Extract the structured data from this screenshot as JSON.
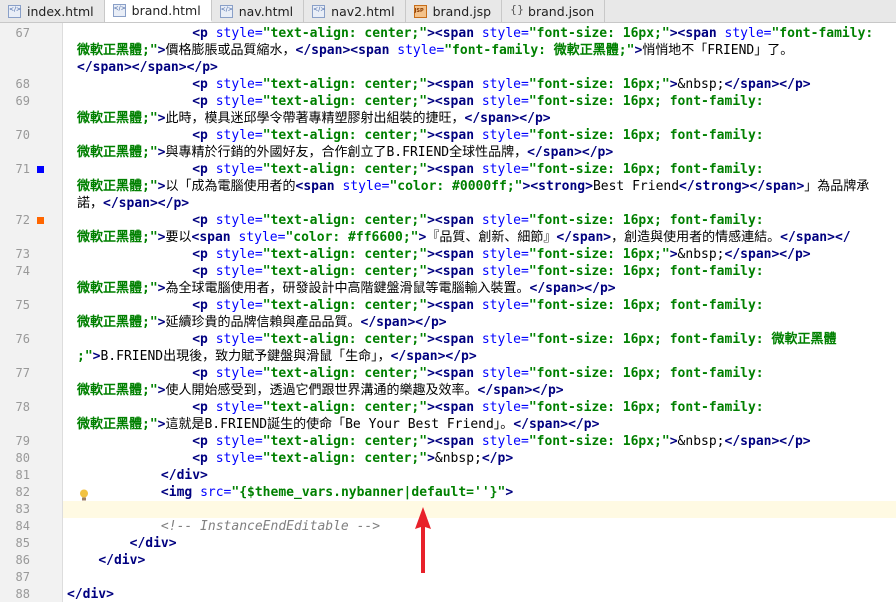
{
  "tabs": [
    {
      "label": "index.html",
      "icon": "html-file-icon",
      "active": false
    },
    {
      "label": "brand.html",
      "icon": "html-file-icon",
      "active": true
    },
    {
      "label": "nav.html",
      "icon": "html-file-icon",
      "active": false
    },
    {
      "label": "nav2.html",
      "icon": "html-file-icon",
      "active": false
    },
    {
      "label": "brand.jsp",
      "icon": "jsp-file-icon",
      "active": false
    },
    {
      "label": "brand.json",
      "icon": "json-file-icon",
      "active": false
    }
  ],
  "colors": {
    "marker_blue": "#0000ff",
    "marker_orange": "#ff6600",
    "arrow_red": "#e8212a"
  },
  "lines": [
    {
      "n": "67",
      "parts": [
        [
          "i",
          "                "
        ],
        [
          "t",
          "<p "
        ],
        [
          "a",
          "style="
        ],
        [
          "v",
          "\"text-align: center;\""
        ],
        [
          "t",
          ">"
        ],
        [
          "t",
          "<span "
        ],
        [
          "a",
          "style="
        ],
        [
          "v",
          "\"font-size: 16px;\""
        ],
        [
          "t",
          ">"
        ],
        [
          "t",
          "<span "
        ],
        [
          "a",
          "style="
        ],
        [
          "v",
          "\"font-family:"
        ]
      ]
    },
    {
      "n": "",
      "wrap": true,
      "parts": [
        [
          "v",
          "微軟正黑體;\""
        ],
        [
          "t",
          ">"
        ],
        [
          "i",
          "價格膨脹或品質縮水，"
        ],
        [
          "t",
          "</span>"
        ],
        [
          "t",
          "<span "
        ],
        [
          "a",
          "style="
        ],
        [
          "v",
          "\"font-family: 微軟正黑體;\""
        ],
        [
          "t",
          ">"
        ],
        [
          "i",
          "悄悄地不「FRIEND」了。"
        ]
      ]
    },
    {
      "n": "",
      "wrap": true,
      "parts": [
        [
          "t",
          "</span></span></p>"
        ]
      ]
    },
    {
      "n": "68",
      "parts": [
        [
          "i",
          "                "
        ],
        [
          "t",
          "<p "
        ],
        [
          "a",
          "style="
        ],
        [
          "v",
          "\"text-align: center;\""
        ],
        [
          "t",
          ">"
        ],
        [
          "t",
          "<span "
        ],
        [
          "a",
          "style="
        ],
        [
          "v",
          "\"font-size: 16px;\""
        ],
        [
          "t",
          ">"
        ],
        [
          "i",
          "&nbsp;"
        ],
        [
          "t",
          "</span></p>"
        ]
      ]
    },
    {
      "n": "69",
      "parts": [
        [
          "i",
          "                "
        ],
        [
          "t",
          "<p "
        ],
        [
          "a",
          "style="
        ],
        [
          "v",
          "\"text-align: center;\""
        ],
        [
          "t",
          ">"
        ],
        [
          "t",
          "<span "
        ],
        [
          "a",
          "style="
        ],
        [
          "v",
          "\"font-size: 16px; font-family:"
        ]
      ]
    },
    {
      "n": "",
      "wrap": true,
      "parts": [
        [
          "v",
          "微軟正黑體;\""
        ],
        [
          "t",
          ">"
        ],
        [
          "i",
          "此時，模具迷邱學令帶著專精塑膠射出組裝的捷旺，"
        ],
        [
          "t",
          "</span></p>"
        ]
      ]
    },
    {
      "n": "70",
      "parts": [
        [
          "i",
          "                "
        ],
        [
          "t",
          "<p "
        ],
        [
          "a",
          "style="
        ],
        [
          "v",
          "\"text-align: center;\""
        ],
        [
          "t",
          ">"
        ],
        [
          "t",
          "<span "
        ],
        [
          "a",
          "style="
        ],
        [
          "v",
          "\"font-size: 16px; font-family:"
        ]
      ]
    },
    {
      "n": "",
      "wrap": true,
      "parts": [
        [
          "v",
          "微軟正黑體;\""
        ],
        [
          "t",
          ">"
        ],
        [
          "i",
          "與專精於行銷的外國好友，合作創立了B.FRIEND全球性品牌，"
        ],
        [
          "t",
          "</span></p>"
        ]
      ]
    },
    {
      "n": "71",
      "mark": "blue",
      "parts": [
        [
          "i",
          "                "
        ],
        [
          "t",
          "<p "
        ],
        [
          "a",
          "style="
        ],
        [
          "v",
          "\"text-align: center;\""
        ],
        [
          "t",
          ">"
        ],
        [
          "t",
          "<span "
        ],
        [
          "a",
          "style="
        ],
        [
          "v",
          "\"font-size: 16px; font-family:"
        ]
      ]
    },
    {
      "n": "",
      "wrap": true,
      "parts": [
        [
          "v",
          "微軟正黑體;\""
        ],
        [
          "t",
          ">"
        ],
        [
          "i",
          "以「成為電腦使用者的"
        ],
        [
          "t",
          "<span "
        ],
        [
          "a",
          "style="
        ],
        [
          "v",
          "\"color: #0000ff;\""
        ],
        [
          "t",
          ">"
        ],
        [
          "t",
          "<strong>"
        ],
        [
          "i",
          "Best Friend"
        ],
        [
          "t",
          "</strong></span>"
        ],
        [
          "i",
          "」為品牌承"
        ]
      ]
    },
    {
      "n": "",
      "wrap": true,
      "parts": [
        [
          "i",
          "諾，"
        ],
        [
          "t",
          "</span></p>"
        ]
      ]
    },
    {
      "n": "72",
      "mark": "orange",
      "parts": [
        [
          "i",
          "                "
        ],
        [
          "t",
          "<p "
        ],
        [
          "a",
          "style="
        ],
        [
          "v",
          "\"text-align: center;\""
        ],
        [
          "t",
          ">"
        ],
        [
          "t",
          "<span "
        ],
        [
          "a",
          "style="
        ],
        [
          "v",
          "\"font-size: 16px; font-family:"
        ]
      ]
    },
    {
      "n": "",
      "wrap": true,
      "parts": [
        [
          "v",
          "微軟正黑體;\""
        ],
        [
          "t",
          ">"
        ],
        [
          "i",
          "要以"
        ],
        [
          "t",
          "<span "
        ],
        [
          "a",
          "style="
        ],
        [
          "v",
          "\"color: #ff6600;\""
        ],
        [
          "t",
          ">"
        ],
        [
          "i",
          "『品質、創新、細節』"
        ],
        [
          "t",
          "</span>"
        ],
        [
          "i",
          "，創造與使用者的情感連結。"
        ],
        [
          "t",
          "</span></"
        ]
      ]
    },
    {
      "n": "73",
      "parts": [
        [
          "i",
          "                "
        ],
        [
          "t",
          "<p "
        ],
        [
          "a",
          "style="
        ],
        [
          "v",
          "\"text-align: center;\""
        ],
        [
          "t",
          ">"
        ],
        [
          "t",
          "<span "
        ],
        [
          "a",
          "style="
        ],
        [
          "v",
          "\"font-size: 16px;\""
        ],
        [
          "t",
          ">"
        ],
        [
          "i",
          "&nbsp;"
        ],
        [
          "t",
          "</span></p>"
        ]
      ]
    },
    {
      "n": "74",
      "parts": [
        [
          "i",
          "                "
        ],
        [
          "t",
          "<p "
        ],
        [
          "a",
          "style="
        ],
        [
          "v",
          "\"text-align: center;\""
        ],
        [
          "t",
          ">"
        ],
        [
          "t",
          "<span "
        ],
        [
          "a",
          "style="
        ],
        [
          "v",
          "\"font-size: 16px; font-family:"
        ]
      ]
    },
    {
      "n": "",
      "wrap": true,
      "parts": [
        [
          "v",
          "微軟正黑體;\""
        ],
        [
          "t",
          ">"
        ],
        [
          "i",
          "為全球電腦使用者，研發設計中高階鍵盤滑鼠等電腦輸入裝置。"
        ],
        [
          "t",
          "</span></p>"
        ]
      ]
    },
    {
      "n": "75",
      "parts": [
        [
          "i",
          "                "
        ],
        [
          "t",
          "<p "
        ],
        [
          "a",
          "style="
        ],
        [
          "v",
          "\"text-align: center;\""
        ],
        [
          "t",
          ">"
        ],
        [
          "t",
          "<span "
        ],
        [
          "a",
          "style="
        ],
        [
          "v",
          "\"font-size: 16px; font-family:"
        ]
      ]
    },
    {
      "n": "",
      "wrap": true,
      "parts": [
        [
          "v",
          "微軟正黑體;\""
        ],
        [
          "t",
          ">"
        ],
        [
          "i",
          "延續珍貴的品牌信賴與產品品質。"
        ],
        [
          "t",
          "</span></p>"
        ]
      ]
    },
    {
      "n": "76",
      "parts": [
        [
          "i",
          "                "
        ],
        [
          "t",
          "<p "
        ],
        [
          "a",
          "style="
        ],
        [
          "v",
          "\"text-align: center;\""
        ],
        [
          "t",
          ">"
        ],
        [
          "t",
          "<span "
        ],
        [
          "a",
          "style="
        ],
        [
          "v",
          "\"font-size: 16px; font-family: 微軟正黑體"
        ]
      ]
    },
    {
      "n": "",
      "wrap": true,
      "parts": [
        [
          "v",
          ";\""
        ],
        [
          "t",
          ">"
        ],
        [
          "i",
          "B.FRIEND出現後，致力賦予鍵盤與滑鼠「生命」，"
        ],
        [
          "t",
          "</span></p>"
        ]
      ]
    },
    {
      "n": "77",
      "parts": [
        [
          "i",
          "                "
        ],
        [
          "t",
          "<p "
        ],
        [
          "a",
          "style="
        ],
        [
          "v",
          "\"text-align: center;\""
        ],
        [
          "t",
          ">"
        ],
        [
          "t",
          "<span "
        ],
        [
          "a",
          "style="
        ],
        [
          "v",
          "\"font-size: 16px; font-family:"
        ]
      ]
    },
    {
      "n": "",
      "wrap": true,
      "parts": [
        [
          "v",
          "微軟正黑體;\""
        ],
        [
          "t",
          ">"
        ],
        [
          "i",
          "使人開始感受到，透過它們跟世界溝通的樂趣及效率。"
        ],
        [
          "t",
          "</span></p>"
        ]
      ]
    },
    {
      "n": "78",
      "parts": [
        [
          "i",
          "                "
        ],
        [
          "t",
          "<p "
        ],
        [
          "a",
          "style="
        ],
        [
          "v",
          "\"text-align: center;\""
        ],
        [
          "t",
          ">"
        ],
        [
          "t",
          "<span "
        ],
        [
          "a",
          "style="
        ],
        [
          "v",
          "\"font-size: 16px; font-family:"
        ]
      ]
    },
    {
      "n": "",
      "wrap": true,
      "parts": [
        [
          "v",
          "微軟正黑體;\""
        ],
        [
          "t",
          ">"
        ],
        [
          "i",
          "這就是B.FRIEND誕生的使命「Be Your Best Friend」。"
        ],
        [
          "t",
          "</span></p>"
        ]
      ]
    },
    {
      "n": "79",
      "parts": [
        [
          "i",
          "                "
        ],
        [
          "t",
          "<p "
        ],
        [
          "a",
          "style="
        ],
        [
          "v",
          "\"text-align: center;\""
        ],
        [
          "t",
          ">"
        ],
        [
          "t",
          "<span "
        ],
        [
          "a",
          "style="
        ],
        [
          "v",
          "\"font-size: 16px;\""
        ],
        [
          "t",
          ">"
        ],
        [
          "i",
          "&nbsp;"
        ],
        [
          "t",
          "</span></p>"
        ]
      ]
    },
    {
      "n": "80",
      "parts": [
        [
          "i",
          "                "
        ],
        [
          "t",
          "<p "
        ],
        [
          "a",
          "style="
        ],
        [
          "v",
          "\"text-align: center;\""
        ],
        [
          "t",
          ">"
        ],
        [
          "i",
          "&nbsp;"
        ],
        [
          "t",
          "</p>"
        ]
      ]
    },
    {
      "n": "81",
      "parts": [
        [
          "i",
          "            "
        ],
        [
          "t",
          "</div>"
        ]
      ]
    },
    {
      "n": "82",
      "bulb": true,
      "parts": [
        [
          "i",
          "            "
        ],
        [
          "t",
          "<img "
        ],
        [
          "a",
          "src="
        ],
        [
          "v",
          "\"{$theme_vars.nybanner|default=''}\""
        ],
        [
          "t",
          ">"
        ]
      ]
    },
    {
      "n": "83",
      "current": true,
      "parts": [
        [
          "i",
          ""
        ]
      ]
    },
    {
      "n": "84",
      "parts": [
        [
          "i",
          "            "
        ],
        [
          "c",
          "<!-- InstanceEndEditable -->"
        ]
      ]
    },
    {
      "n": "85",
      "parts": [
        [
          "i",
          "        "
        ],
        [
          "t",
          "</div>"
        ]
      ]
    },
    {
      "n": "86",
      "parts": [
        [
          "i",
          "    "
        ],
        [
          "t",
          "</div>"
        ]
      ]
    },
    {
      "n": "87",
      "parts": [
        [
          "i",
          ""
        ]
      ]
    },
    {
      "n": "88",
      "parts": [
        [
          "t",
          "</div>"
        ]
      ]
    }
  ]
}
